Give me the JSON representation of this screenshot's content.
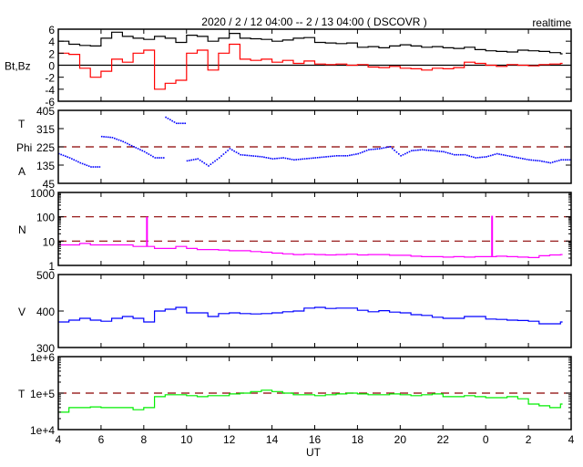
{
  "title": "2020 / 2 / 12   04:00 -- 2 / 13  04:00 ( DSCOVR )",
  "mode_label": "realtime",
  "colors": {
    "bt": "#000000",
    "bz": "#ff0000",
    "phi": "#0000ff",
    "n": "#ff00ff",
    "v": "#0000ff",
    "t": "#00ee00",
    "ref": "#8b0000"
  },
  "chart_data": {
    "type": "line",
    "xlabel": "UT",
    "x_range": [
      4,
      28
    ],
    "x_ticks": [
      4,
      6,
      8,
      10,
      12,
      14,
      16,
      18,
      20,
      22,
      24,
      26,
      28
    ],
    "x_tick_labels": [
      "4",
      "6",
      "8",
      "10",
      "12",
      "14",
      "16",
      "18",
      "20",
      "22",
      "0",
      "2",
      "4"
    ],
    "x": [
      4,
      4.5,
      5,
      5.5,
      6,
      6.5,
      7,
      7.5,
      8,
      8.5,
      9,
      9.5,
      10,
      10.5,
      11,
      11.5,
      12,
      12.5,
      13,
      13.5,
      14,
      14.5,
      15,
      15.5,
      16,
      16.5,
      17,
      17.5,
      18,
      18.5,
      19,
      19.5,
      20,
      20.5,
      21,
      21.5,
      22,
      22.5,
      23,
      23.5,
      24,
      24.5,
      25,
      25.5,
      26,
      26.5,
      27,
      27.5
    ],
    "panels": [
      {
        "ylabel_lines": [
          "Bt,Bz"
        ],
        "ylim": [
          -6,
          6
        ],
        "scale": "linear",
        "y_ticks": [
          6,
          4,
          2,
          0,
          -2,
          -4,
          -6
        ],
        "y_tick_labels": [
          "6",
          "4",
          "2",
          "0",
          "-2",
          "-4",
          "-6"
        ],
        "ref_lines": [],
        "zero_line": 0,
        "series": [
          {
            "name": "Bt",
            "color_key": "bt",
            "style": "line",
            "values": [
              4,
              3.5,
              3.3,
              3.2,
              4.5,
              5.5,
              4.8,
              4.5,
              4.3,
              4.8,
              4.5,
              3.8,
              5,
              4.8,
              4,
              4.5,
              5.3,
              4.5,
              4.4,
              4.3,
              4,
              4.2,
              4.5,
              4.6,
              3.8,
              3.7,
              3.6,
              3.7,
              3,
              3.1,
              2.9,
              3.2,
              3.4,
              3.2,
              3,
              3.1,
              2.9,
              2.8,
              3,
              2.6,
              2.4,
              2.3,
              2.2,
              2.5,
              2.4,
              2.3,
              2.1,
              1.9
            ]
          },
          {
            "name": "Bz",
            "color_key": "bz",
            "style": "line",
            "values": [
              2,
              1.8,
              -0.5,
              -2,
              -1,
              1,
              0.5,
              2,
              2.5,
              -4,
              -3,
              -2.5,
              2,
              2.5,
              -0.8,
              2,
              3.5,
              1,
              0.8,
              1,
              0.5,
              0.8,
              0.3,
              0.7,
              0.2,
              0.1,
              0.2,
              0,
              0.1,
              -0.3,
              -0.4,
              -0.2,
              -0.5,
              -0.6,
              -0.8,
              -0.5,
              -0.6,
              -0.4,
              0.5,
              0.3,
              0,
              -0.2,
              0.1,
              0,
              -0.1,
              0.1,
              0.2,
              0.3
            ]
          }
        ]
      },
      {
        "ylabel_lines": [
          "T",
          "Phi",
          "A"
        ],
        "ylim": [
          45,
          405
        ],
        "scale": "linear",
        "y_ticks": [
          405,
          315,
          225,
          135,
          45
        ],
        "y_tick_labels": [
          "405",
          "315",
          "225",
          "135",
          "45"
        ],
        "ref_lines": [
          225
        ],
        "series": [
          {
            "name": "Phi",
            "color_key": "phi",
            "style": "dots",
            "values": [
              190,
              170,
              145,
              125,
              275,
              270,
              250,
              225,
              200,
              170,
              370,
              340,
              155,
              165,
              130,
              170,
              215,
              185,
              180,
              175,
              165,
              170,
              160,
              165,
              170,
              175,
              180,
              180,
              190,
              210,
              215,
              225,
              180,
              205,
              210,
              205,
              200,
              185,
              185,
              170,
              175,
              190,
              180,
              170,
              160,
              155,
              145,
              160
            ]
          }
        ]
      },
      {
        "ylabel_lines": [
          "N"
        ],
        "ylim": [
          1,
          1000
        ],
        "scale": "log",
        "y_ticks": [
          1000,
          100,
          10,
          1
        ],
        "y_tick_labels": [
          "1000",
          "100",
          "10",
          "1"
        ],
        "ref_lines": [
          100,
          10
        ],
        "spikes": [
          {
            "x": 8.15,
            "value": 100
          },
          {
            "x": 24.3,
            "value": 110
          }
        ],
        "series": [
          {
            "name": "N",
            "color_key": "n",
            "style": "line",
            "values": [
              7,
              7,
              8,
              7,
              7,
              7,
              7,
              6,
              6,
              5,
              5,
              6,
              5,
              4.5,
              4.5,
              4.3,
              4,
              4,
              3.7,
              3.5,
              3.2,
              3,
              2.8,
              2.9,
              2.8,
              2.7,
              2.8,
              2.9,
              2.7,
              2.8,
              2.8,
              2.6,
              2.6,
              2.4,
              2.3,
              2.3,
              2.2,
              2.3,
              2.2,
              2.3,
              2.3,
              2.4,
              2.3,
              2.2,
              2.1,
              2.5,
              2.7,
              2.8
            ]
          }
        ]
      },
      {
        "ylabel_lines": [
          "V"
        ],
        "ylim": [
          300,
          500
        ],
        "scale": "linear",
        "y_ticks": [
          500,
          400,
          300
        ],
        "y_tick_labels": [
          "500",
          "400",
          "300"
        ],
        "ref_lines": [],
        "series": [
          {
            "name": "V",
            "color_key": "v",
            "style": "line",
            "values": [
              370,
              375,
              380,
              375,
              372,
              380,
              385,
              380,
              370,
              400,
              405,
              410,
              395,
              395,
              385,
              393,
              395,
              393,
              392,
              393,
              395,
              398,
              400,
              408,
              410,
              407,
              408,
              408,
              402,
              398,
              401,
              397,
              395,
              390,
              388,
              383,
              380,
              380,
              385,
              385,
              378,
              377,
              375,
              374,
              372,
              365,
              365,
              370
            ]
          }
        ]
      },
      {
        "ylabel_lines": [
          "T"
        ],
        "ylim": [
          10000,
          1000000
        ],
        "scale": "log",
        "y_ticks": [
          1000000,
          100000,
          10000
        ],
        "y_tick_labels": [
          "1e+6",
          "1e+5",
          "1e+4"
        ],
        "ref_lines": [
          100000
        ],
        "series": [
          {
            "name": "T",
            "color_key": "t",
            "style": "line",
            "values": [
              30000,
              40000,
              40000,
              42000,
              40000,
              40000,
              40000,
              35000,
              40000,
              80000,
              90000,
              90000,
              85000,
              80000,
              85000,
              85000,
              95000,
              100000,
              110000,
              120000,
              110000,
              100000,
              90000,
              90000,
              85000,
              90000,
              95000,
              100000,
              95000,
              90000,
              90000,
              95000,
              90000,
              85000,
              90000,
              95000,
              80000,
              80000,
              85000,
              80000,
              75000,
              75000,
              80000,
              70000,
              50000,
              45000,
              40000,
              50000
            ]
          }
        ]
      }
    ]
  }
}
